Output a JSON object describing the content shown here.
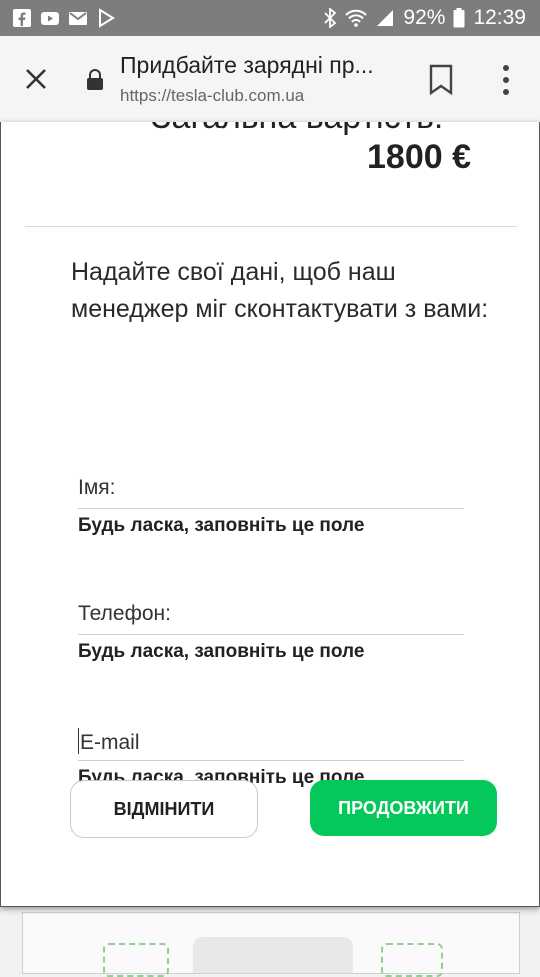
{
  "status_bar": {
    "battery_percent": "92%",
    "time": "12:39",
    "icons_left": [
      "facebook-icon",
      "youtube-icon",
      "gmail-icon",
      "play-store-icon"
    ],
    "icons_right": [
      "bluetooth-icon",
      "wifi-icon",
      "signal-icon",
      "battery-icon"
    ]
  },
  "browser": {
    "page_title": "Придбайте зарядні пр...",
    "url": "https://tesla-club.com.ua"
  },
  "modal": {
    "cut_heading": "Загальна вартість:",
    "total_price": "1800 €",
    "intro_text": "Надайте свої дані, щоб наш менеджер міг сконтактувати з вами:",
    "fields": [
      {
        "label": "Імя:",
        "error": "Будь ласка, заповніть це поле"
      },
      {
        "label": "Телефон:",
        "error": "Будь ласка, заповніть це поле"
      },
      {
        "label": "E-mail",
        "error": "Будь ласка, заповніть це поле"
      }
    ],
    "cancel_label": "ВІДМІНИТИ",
    "continue_label": "ПРОДОВЖИТИ"
  },
  "colors": {
    "accent": "#05c85a",
    "status_bar": "#7d7d7d"
  }
}
